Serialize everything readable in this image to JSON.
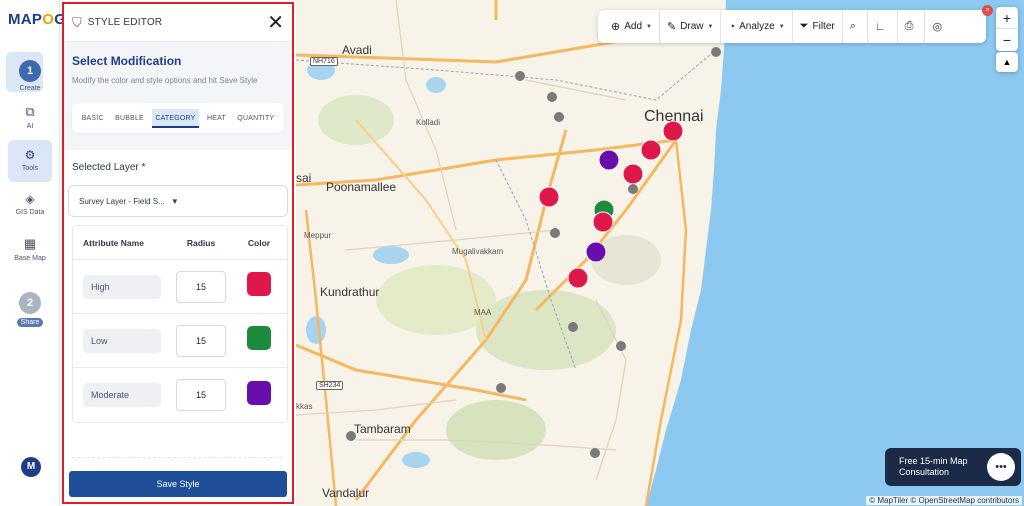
{
  "app": {
    "logo_text_a": "MAP",
    "logo_text_o": "O",
    "logo_text_b": "G"
  },
  "rail": {
    "items": [
      {
        "label": "Create",
        "step": "1"
      },
      {
        "label": "AI"
      },
      {
        "label": "Tools"
      },
      {
        "label": "GIS Data"
      },
      {
        "label": "Base Map"
      },
      {
        "label": "Share",
        "step": "2"
      }
    ],
    "avatar": "M"
  },
  "panel": {
    "title": "STYLE EDITOR",
    "close": "✕",
    "heading": "Select Modification",
    "subheading": "Modify the color and style options and hit Save Style",
    "tabs": [
      "BASIC",
      "BUBBLE",
      "CATEGORY",
      "HEAT",
      "QUANTITY"
    ],
    "active_tab": "CATEGORY",
    "layer_label": "Selected Layer *",
    "layer_value": "Survey Layer - Field S...",
    "table": {
      "headers": [
        "Attribute Name",
        "Radius",
        "Color"
      ],
      "rows": [
        {
          "name": "High",
          "radius": "15",
          "color": "#e0174a"
        },
        {
          "name": "Low",
          "radius": "15",
          "color": "#1e8a3c"
        },
        {
          "name": "Moderate",
          "radius": "15",
          "color": "#6a0dad"
        }
      ]
    },
    "save_label": "Save Style"
  },
  "toolbar": {
    "add": "Add",
    "draw": "Draw",
    "analyze": "Analyze",
    "filter": "Filter"
  },
  "map": {
    "places": {
      "avadi": "Avadi",
      "chennai": "Chennai",
      "poonamallee": "Poonamallee",
      "kolladi": "Kolladi",
      "meppur": "Meppur",
      "mugalivakkam": "Mugalivakkam",
      "kundrathur": "Kundrathur",
      "maa": "MAA",
      "tambaram": "Tambaram",
      "vandalur": "Vandalur",
      "sai": "sai",
      "kkas": "kkas"
    },
    "shields": {
      "nh716": "NH716",
      "sh234": "SH234"
    },
    "zoom_in": "+",
    "zoom_out": "−",
    "compass": "▲"
  },
  "consult": {
    "line1": "Free 15-min Map",
    "line2": "Consultation",
    "icon": "•••"
  },
  "attribution": "© MapTiler © OpenStreetMap contributors",
  "badge": "×",
  "colors": {
    "accent": "#1f3c88",
    "high": "#e0174a",
    "low": "#1e8a3c",
    "moderate": "#6a0dad",
    "neutral": "#7a7a7a",
    "water": "#8cc8f0"
  },
  "markers": [
    {
      "cat": "neutral"
    },
    {
      "cat": "neutral"
    },
    {
      "cat": "neutral"
    },
    {
      "cat": "neutral"
    },
    {
      "cat": "high"
    },
    {
      "cat": "high"
    },
    {
      "cat": "moderate"
    },
    {
      "cat": "high"
    },
    {
      "cat": "high"
    },
    {
      "cat": "low"
    },
    {
      "cat": "high"
    },
    {
      "cat": "neutral"
    },
    {
      "cat": "neutral"
    },
    {
      "cat": "moderate"
    },
    {
      "cat": "high"
    },
    {
      "cat": "neutral"
    },
    {
      "cat": "neutral"
    },
    {
      "cat": "neutral"
    },
    {
      "cat": "neutral"
    },
    {
      "cat": "neutral"
    },
    {
      "cat": "neutral"
    }
  ]
}
